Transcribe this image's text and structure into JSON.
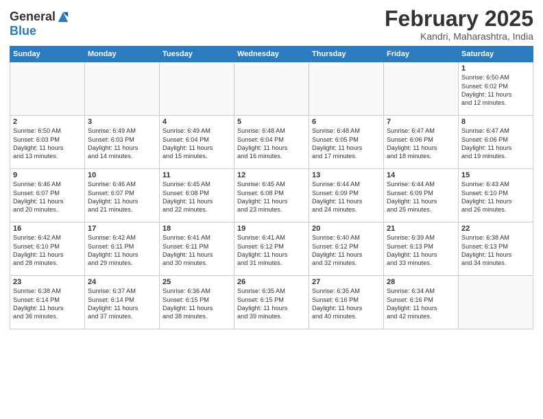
{
  "header": {
    "logo_line1": "General",
    "logo_line2": "Blue",
    "month_title": "February 2025",
    "location": "Kandri, Maharashtra, India"
  },
  "weekdays": [
    "Sunday",
    "Monday",
    "Tuesday",
    "Wednesday",
    "Thursday",
    "Friday",
    "Saturday"
  ],
  "weeks": [
    [
      {
        "day": "",
        "info": ""
      },
      {
        "day": "",
        "info": ""
      },
      {
        "day": "",
        "info": ""
      },
      {
        "day": "",
        "info": ""
      },
      {
        "day": "",
        "info": ""
      },
      {
        "day": "",
        "info": ""
      },
      {
        "day": "1",
        "info": "Sunrise: 6:50 AM\nSunset: 6:02 PM\nDaylight: 11 hours\nand 12 minutes."
      }
    ],
    [
      {
        "day": "2",
        "info": "Sunrise: 6:50 AM\nSunset: 6:03 PM\nDaylight: 11 hours\nand 13 minutes."
      },
      {
        "day": "3",
        "info": "Sunrise: 6:49 AM\nSunset: 6:03 PM\nDaylight: 11 hours\nand 14 minutes."
      },
      {
        "day": "4",
        "info": "Sunrise: 6:49 AM\nSunset: 6:04 PM\nDaylight: 11 hours\nand 15 minutes."
      },
      {
        "day": "5",
        "info": "Sunrise: 6:48 AM\nSunset: 6:04 PM\nDaylight: 11 hours\nand 16 minutes."
      },
      {
        "day": "6",
        "info": "Sunrise: 6:48 AM\nSunset: 6:05 PM\nDaylight: 11 hours\nand 17 minutes."
      },
      {
        "day": "7",
        "info": "Sunrise: 6:47 AM\nSunset: 6:06 PM\nDaylight: 11 hours\nand 18 minutes."
      },
      {
        "day": "8",
        "info": "Sunrise: 6:47 AM\nSunset: 6:06 PM\nDaylight: 11 hours\nand 19 minutes."
      }
    ],
    [
      {
        "day": "9",
        "info": "Sunrise: 6:46 AM\nSunset: 6:07 PM\nDaylight: 11 hours\nand 20 minutes."
      },
      {
        "day": "10",
        "info": "Sunrise: 6:46 AM\nSunset: 6:07 PM\nDaylight: 11 hours\nand 21 minutes."
      },
      {
        "day": "11",
        "info": "Sunrise: 6:45 AM\nSunset: 6:08 PM\nDaylight: 11 hours\nand 22 minutes."
      },
      {
        "day": "12",
        "info": "Sunrise: 6:45 AM\nSunset: 6:08 PM\nDaylight: 11 hours\nand 23 minutes."
      },
      {
        "day": "13",
        "info": "Sunrise: 6:44 AM\nSunset: 6:09 PM\nDaylight: 11 hours\nand 24 minutes."
      },
      {
        "day": "14",
        "info": "Sunrise: 6:44 AM\nSunset: 6:09 PM\nDaylight: 11 hours\nand 25 minutes."
      },
      {
        "day": "15",
        "info": "Sunrise: 6:43 AM\nSunset: 6:10 PM\nDaylight: 11 hours\nand 26 minutes."
      }
    ],
    [
      {
        "day": "16",
        "info": "Sunrise: 6:42 AM\nSunset: 6:10 PM\nDaylight: 11 hours\nand 28 minutes."
      },
      {
        "day": "17",
        "info": "Sunrise: 6:42 AM\nSunset: 6:11 PM\nDaylight: 11 hours\nand 29 minutes."
      },
      {
        "day": "18",
        "info": "Sunrise: 6:41 AM\nSunset: 6:11 PM\nDaylight: 11 hours\nand 30 minutes."
      },
      {
        "day": "19",
        "info": "Sunrise: 6:41 AM\nSunset: 6:12 PM\nDaylight: 11 hours\nand 31 minutes."
      },
      {
        "day": "20",
        "info": "Sunrise: 6:40 AM\nSunset: 6:12 PM\nDaylight: 11 hours\nand 32 minutes."
      },
      {
        "day": "21",
        "info": "Sunrise: 6:39 AM\nSunset: 6:13 PM\nDaylight: 11 hours\nand 33 minutes."
      },
      {
        "day": "22",
        "info": "Sunrise: 6:38 AM\nSunset: 6:13 PM\nDaylight: 11 hours\nand 34 minutes."
      }
    ],
    [
      {
        "day": "23",
        "info": "Sunrise: 6:38 AM\nSunset: 6:14 PM\nDaylight: 11 hours\nand 36 minutes."
      },
      {
        "day": "24",
        "info": "Sunrise: 6:37 AM\nSunset: 6:14 PM\nDaylight: 11 hours\nand 37 minutes."
      },
      {
        "day": "25",
        "info": "Sunrise: 6:36 AM\nSunset: 6:15 PM\nDaylight: 11 hours\nand 38 minutes."
      },
      {
        "day": "26",
        "info": "Sunrise: 6:35 AM\nSunset: 6:15 PM\nDaylight: 11 hours\nand 39 minutes."
      },
      {
        "day": "27",
        "info": "Sunrise: 6:35 AM\nSunset: 6:16 PM\nDaylight: 11 hours\nand 40 minutes."
      },
      {
        "day": "28",
        "info": "Sunrise: 6:34 AM\nSunset: 6:16 PM\nDaylight: 11 hours\nand 42 minutes."
      },
      {
        "day": "",
        "info": ""
      }
    ]
  ]
}
